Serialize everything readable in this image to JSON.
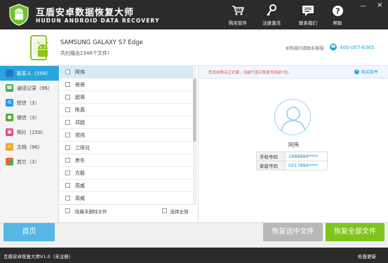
{
  "header": {
    "title": "互盾安卓数据恢复大师",
    "subtitle": "HUDUN ANDROID DATA RECOVERY",
    "actions": [
      {
        "label": "购买软件",
        "icon": "cart-icon"
      },
      {
        "label": "注册激活",
        "icon": "key-icon"
      },
      {
        "label": "联系我们",
        "icon": "chat-icon"
      },
      {
        "label": "帮助",
        "icon": "help-icon"
      }
    ],
    "minimize": "—",
    "close": "×"
  },
  "device": {
    "name": "SAMSUNG  GALAXY S7 Edge",
    "count_text": "共扫描出2346个文件!",
    "contact_label": "如有疑问请联系客服:",
    "contact_phone": "400-007-6365"
  },
  "sidebar": {
    "items": [
      {
        "label": "联系人（558）",
        "color": "#2aa4dd",
        "icon": "contacts-icon"
      },
      {
        "label": "通话记录（96）",
        "color": "#4caf50",
        "icon": "phone-icon"
      },
      {
        "label": "短信（3）",
        "color": "#2196f3",
        "icon": "message-icon"
      },
      {
        "label": "微信（3）",
        "color": "#4cae3c",
        "icon": "wechat-icon"
      },
      {
        "label": "照片（159）",
        "color": "#e64a88",
        "icon": "photo-icon"
      },
      {
        "label": "文档（96）",
        "color": "#f5a623",
        "icon": "document-icon"
      },
      {
        "label": "其它（3）",
        "color": "#ff5e3a",
        "icon": "other-icon"
      }
    ]
  },
  "list": {
    "items": [
      "阿伟",
      "爸爸",
      "超哥",
      "陈真",
      "邓超",
      "郑伟",
      "二师兄",
      "房东",
      "方毅",
      "高威",
      "高威"
    ],
    "footer_hide": "隐藏未删除文件",
    "footer_select_all": "选择全部"
  },
  "detail": {
    "notice": "您尚未购买正式版，当前只显示恢复号码前7位。",
    "buy": "购买软件",
    "name": "阿伟",
    "fields": [
      {
        "key": "手机号码",
        "value": "1888888****"
      },
      {
        "key": "家庭号码",
        "value": "0217896****"
      }
    ]
  },
  "buttons": {
    "home": "首页",
    "recover_selected": "恢复选中文件",
    "recover_all": "恢复全部文件"
  },
  "status": {
    "left": "互盾安卓恢复大师V1.0（未注册）",
    "right": "检查更新"
  }
}
